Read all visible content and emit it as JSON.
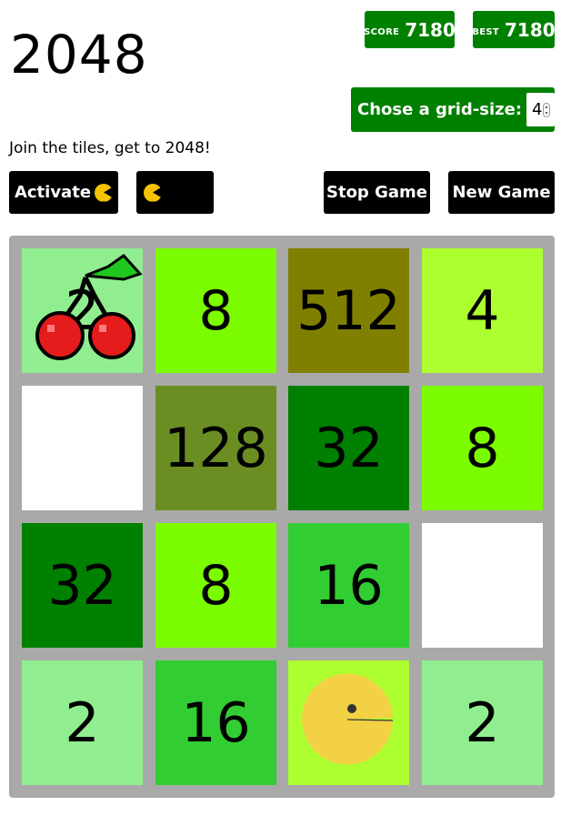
{
  "header": {
    "title": "2048",
    "score_label": "SCORE",
    "score_value": "7180",
    "best_label": "BEST",
    "best_value": "7180",
    "grid_size_label": "Chose a grid-size:",
    "grid_size_value": "4",
    "subtitle": "Join the tiles, get to 2048!"
  },
  "controls": {
    "activate_label": "Activate",
    "stop_label": "Stop Game",
    "new_label": "New Game"
  },
  "board": {
    "size": 4,
    "tiles": [
      {
        "value": "2",
        "color": "#90ee90",
        "overlay": "cherry"
      },
      {
        "value": "8",
        "color": "#7cfc00"
      },
      {
        "value": "512",
        "color": "#808000"
      },
      {
        "value": "4",
        "color": "#adff2f"
      },
      {
        "value": "",
        "color": "#ffffff"
      },
      {
        "value": "128",
        "color": "#6b8e23"
      },
      {
        "value": "32",
        "color": "#008000"
      },
      {
        "value": "8",
        "color": "#7cfc00"
      },
      {
        "value": "32",
        "color": "#008000"
      },
      {
        "value": "8",
        "color": "#7cfc00"
      },
      {
        "value": "16",
        "color": "#32cd32"
      },
      {
        "value": "",
        "color": "#ffffff"
      },
      {
        "value": "2",
        "color": "#90ee90"
      },
      {
        "value": "16",
        "color": "#32cd32"
      },
      {
        "value": "",
        "color": "#adff2f",
        "overlay": "pacman"
      },
      {
        "value": "2",
        "color": "#90ee90"
      }
    ]
  },
  "colors": {
    "accent_green": "#008000",
    "board_bg": "#a9a9a9",
    "pacman_yellow": "#f2d144"
  }
}
